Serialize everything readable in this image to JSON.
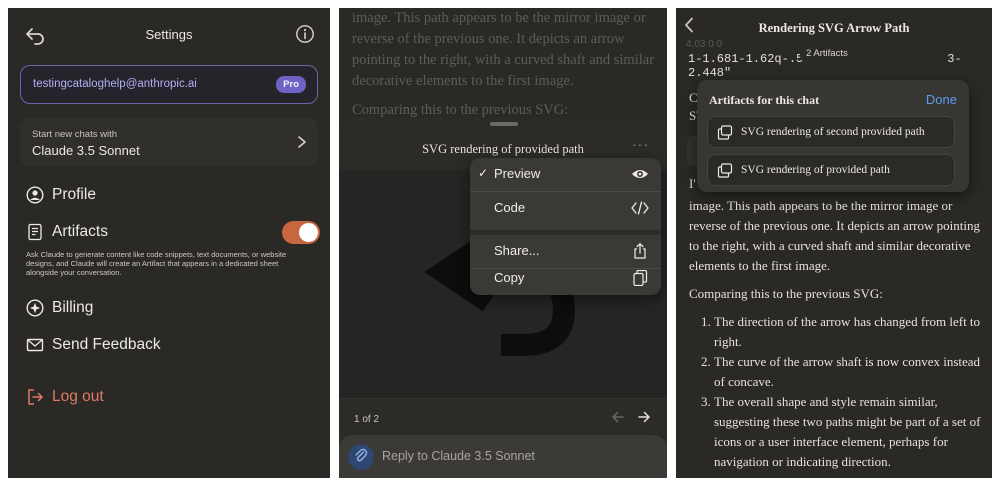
{
  "settings": {
    "title": "Settings",
    "email": "testingcataloghelp@anthropic.ai",
    "plan_badge": "Pro",
    "model_label": "Start new chats with",
    "model_name": "Claude 3.5 Sonnet",
    "menu": {
      "profile": "Profile",
      "artifacts": "Artifacts",
      "billing": "Billing",
      "feedback": "Send Feedback",
      "logout": "Log out"
    },
    "artifacts_enabled": true,
    "artifacts_description": "Ask Claude to generate content like code snippets, text documents, or website designs, and Claude will create an Artifact that appears in a dedicated sheet alongside your conversation."
  },
  "artifact_sheet": {
    "background_text": [
      "image. This path appears to be the mirror image or reverse of the previous one. It depicts an arrow pointing to the right, with a curved shaft and similar decorative elements to the first image.",
      "Comparing this to the previous SVG:"
    ],
    "title": "SVG rendering of provided path",
    "menu_dots": "···",
    "page_count": "1 of 2",
    "reply_placeholder": "Reply to Claude 3.5 Sonnet",
    "context_menu": {
      "checkmark": "✓",
      "preview": "Preview",
      "code": "Code",
      "share": "Share...",
      "copy": "Copy"
    }
  },
  "artifacts_popover": {
    "nav_title": "Rendering SVG Arrow Path",
    "code_fragment_top": "4.03 0 0",
    "code_fragment": "1-1.681-1.62q-.58                   3-2.448\"",
    "artifacts_pill": "2 Artifacts",
    "popover_title": "Artifacts for this chat",
    "done": "Done",
    "items": [
      "SVG rendering of second provided path",
      "SVG rendering of provided path"
    ],
    "partial_c": "C",
    "partial_s": "S\\",
    "partial_i": "I'",
    "body_paragraph": "image. This path appears to be the mirror image or reverse of the previous one. It depicts an arrow pointing to the right, with a curved shaft and similar decorative elements to the first image.",
    "comparing": "Comparing this to the previous SVG:",
    "list": [
      "The direction of the arrow has changed from left to right.",
      "The curve of the arrow shaft is now convex instead of concave.",
      "The overall shape and style remain similar, suggesting these two paths might be part of a set of icons or a user interface element, perhaps for navigation or indicating direction."
    ]
  },
  "colors": {
    "accent_orange": "#c8663f",
    "pro_purple": "#6e63c4",
    "done_blue": "#5b9bec",
    "logout_red": "#e07a62"
  }
}
